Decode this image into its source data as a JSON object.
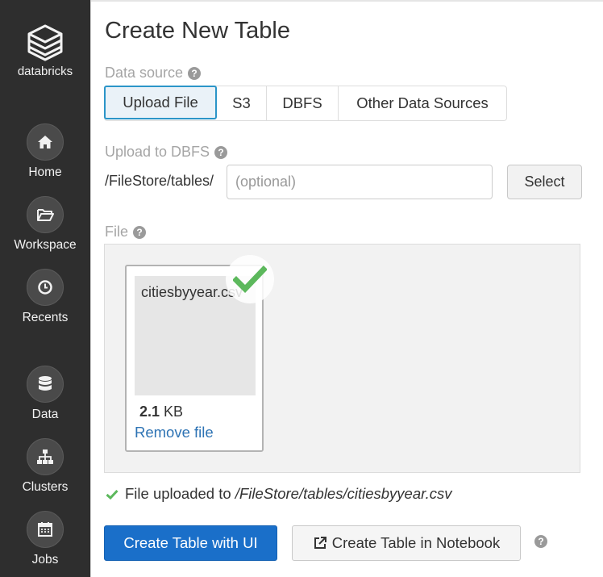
{
  "sidebar": {
    "logo_text": "databricks",
    "items": [
      {
        "label": "Home",
        "icon": "home-icon"
      },
      {
        "label": "Workspace",
        "icon": "folder-icon"
      },
      {
        "label": "Recents",
        "icon": "clock-icon"
      },
      {
        "label": "Data",
        "icon": "database-icon"
      },
      {
        "label": "Clusters",
        "icon": "clusters-icon"
      },
      {
        "label": "Jobs",
        "icon": "calendar-icon"
      }
    ]
  },
  "page": {
    "title": "Create New Table"
  },
  "data_source": {
    "label": "Data source",
    "tabs": [
      "Upload File",
      "S3",
      "DBFS",
      "Other Data Sources"
    ],
    "active_tab": "Upload File"
  },
  "upload": {
    "label": "Upload to DBFS",
    "path_prefix": "/FileStore/tables/",
    "input_value": "",
    "input_placeholder": "(optional)",
    "select_label": "Select"
  },
  "file": {
    "label": "File",
    "name": "citiesbyyear.csv",
    "size_value": "2.1",
    "size_unit": "KB",
    "remove_label": "Remove file",
    "status_prefix": "File uploaded to ",
    "status_path": "/FileStore/tables/citiesbyyear.csv"
  },
  "actions": {
    "create_ui_label": "Create Table with UI",
    "create_notebook_label": "Create Table in Notebook"
  },
  "colors": {
    "sidebar_bg": "#2e2e2e",
    "primary_button": "#1a6fc9",
    "active_tab_border": "#2b95c8",
    "success_green": "#5cb85c",
    "link": "#2d73b4"
  }
}
